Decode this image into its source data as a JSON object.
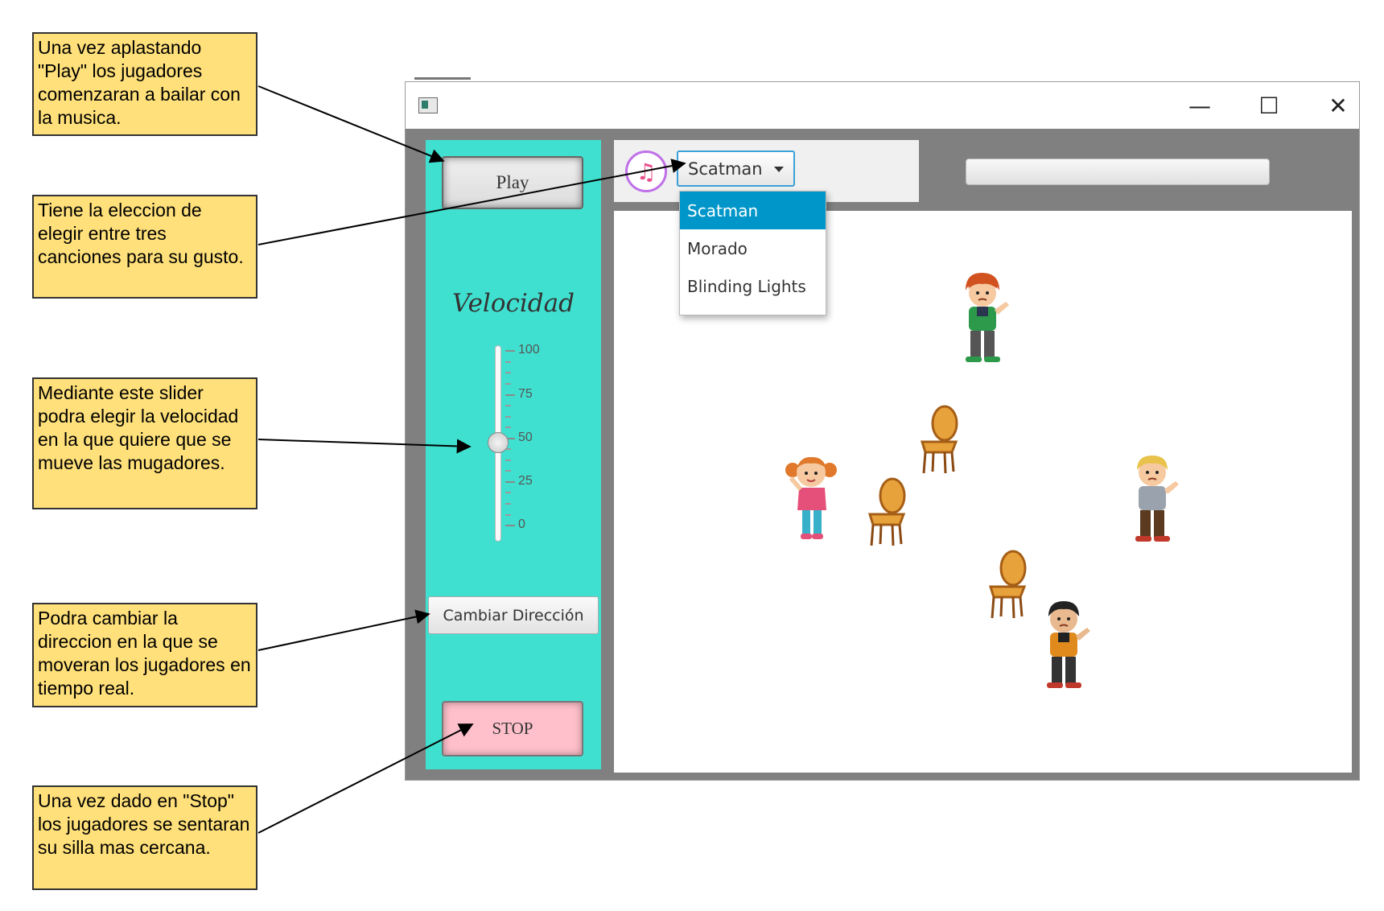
{
  "annotations": [
    "Una vez aplastando \"Play\" los jugadores comenzaran a bailar con la musica.",
    "Tiene la eleccion de elegir entre tres canciones para su gusto.",
    "Mediante este slider podra elegir la velocidad en la que quiere que se mueve las mugadores.",
    "Podra cambiar la direccion en la que se moveran los jugadores en tiempo real.",
    "Una vez dado en \"Stop\" los jugadores se sentaran su silla mas cercana."
  ],
  "window": {
    "controls": {
      "minimize": "—",
      "maximize": "☐",
      "close": "✕"
    }
  },
  "controls": {
    "play_label": "Play",
    "speed_label": "Velocidad",
    "speed_value": 50,
    "speed_ticks": [
      "100",
      "75",
      "50",
      "25",
      "0"
    ],
    "direction_label": "Cambiar Dirección",
    "stop_label": "STOP"
  },
  "music": {
    "icon": "music-note-icon",
    "selected_song": "Scatman",
    "songs": [
      "Scatman",
      "Morado",
      "Blinding Lights"
    ],
    "progress": 0
  },
  "stage": {
    "players": [
      "boy-red-hair",
      "girl-pigtails",
      "boy-blond",
      "boy-black-hair"
    ],
    "chairs": 3
  },
  "colors": {
    "note_bg": "#ffe07a",
    "panel_bg": "#40e0d0",
    "stop_bg": "#ffc0cb",
    "selection": "#0096c9"
  }
}
